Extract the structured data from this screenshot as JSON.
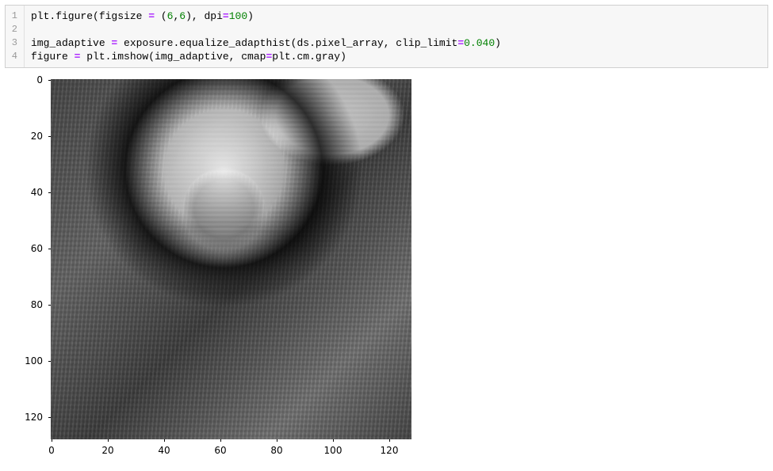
{
  "code": {
    "lines": [
      "1",
      "2",
      "3",
      "4"
    ],
    "l1_a": "plt",
    "l1_b": ".figure(figsize ",
    "l1_eq": "=",
    "l1_c": " (",
    "l1_n1": "6",
    "l1_comma": ",",
    "l1_n2": "6",
    "l1_d": "), dpi",
    "l1_eq2": "=",
    "l1_n3": "100",
    "l1_e": ")",
    "l3_a": "img_adaptive ",
    "l3_eq": "=",
    "l3_b": " exposure.equalize_adapthist(ds.pixel_array, clip_limit",
    "l3_eq2": "=",
    "l3_n1": "0.040",
    "l3_c": ")",
    "l4_a": "figure ",
    "l4_eq": "=",
    "l4_b": " plt.imshow(img_adaptive, cmap",
    "l4_eq2": "=",
    "l4_c": "plt.cm.gray)"
  },
  "chart_data": {
    "type": "heatmap",
    "title": "",
    "xlabel": "",
    "ylabel": "",
    "xlim": [
      0,
      128
    ],
    "ylim": [
      128,
      0
    ],
    "x_ticks": [
      "0",
      "20",
      "40",
      "60",
      "80",
      "100",
      "120"
    ],
    "y_ticks": [
      "0",
      "20",
      "40",
      "60",
      "80",
      "100",
      "120"
    ],
    "cmap": "gray",
    "description": "CT axial slice (adaptive histogram equalized) showing vertebral body with central dark circular canal, bright cortical bone ring, and surrounding soft tissue with streak artifacts; bright rounded structure upper-right."
  }
}
